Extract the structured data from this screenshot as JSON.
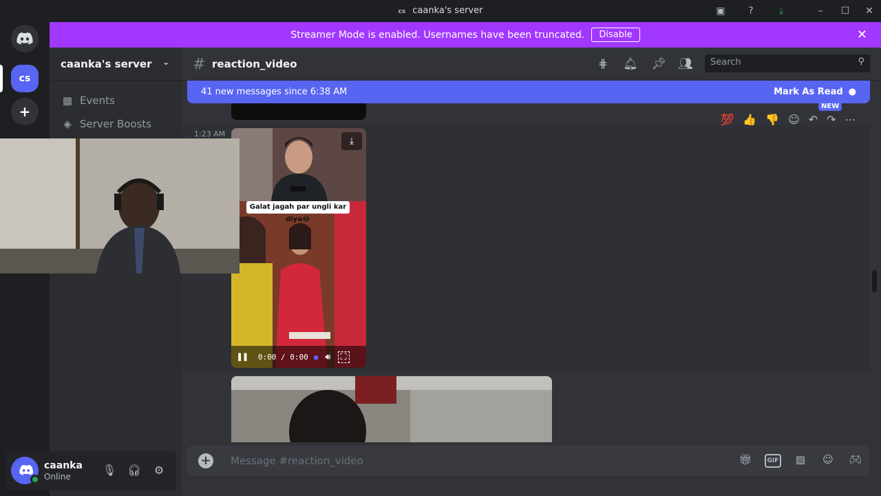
{
  "window": {
    "server_badge": "cs",
    "title": "caanka's server"
  },
  "banner": {
    "text": "Streamer Mode is enabled. Usernames have been truncated.",
    "button": "Disable"
  },
  "rail": {
    "server_abbrev": "cs"
  },
  "sidebar": {
    "server_name": "caanka's server",
    "items": [
      {
        "label": "Events",
        "icon": "calendar-icon"
      },
      {
        "label": "Server Boosts",
        "icon": "boost-icon"
      }
    ]
  },
  "user": {
    "name": "caanka",
    "status": "Online"
  },
  "channel": {
    "name": "reaction_video",
    "search_placeholder": "Search"
  },
  "new_messages": {
    "text": "41 new messages since 6:38 AM",
    "action": "Mark As Read"
  },
  "message": {
    "timestamp": "1:23 AM",
    "video_caption": "Galat jagah par ungli kar diya😂",
    "video_time": "0:00 / 0:00"
  },
  "toolbar": {
    "new_tag": "NEW",
    "reactions": [
      "💯",
      "👍",
      "👎"
    ]
  },
  "composer": {
    "placeholder": "Message #reaction_video",
    "gif_label": "GIF"
  },
  "colors": {
    "banner": "#a238ff",
    "blurple": "#5865f2",
    "online": "#23a55a"
  }
}
